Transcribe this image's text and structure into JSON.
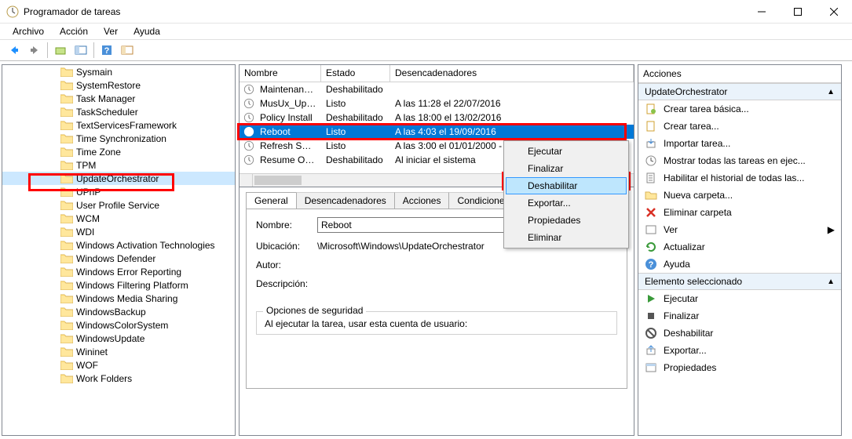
{
  "window": {
    "title": "Programador de tareas"
  },
  "menu": {
    "file": "Archivo",
    "action": "Acción",
    "view": "Ver",
    "help": "Ayuda"
  },
  "tree": {
    "items": [
      "Sysmain",
      "SystemRestore",
      "Task Manager",
      "TaskScheduler",
      "TextServicesFramework",
      "Time Synchronization",
      "Time Zone",
      "TPM",
      "UpdateOrchestrator",
      "UPnP",
      "User Profile Service",
      "WCM",
      "WDI",
      "Windows Activation Technologies",
      "Windows Defender",
      "Windows Error Reporting",
      "Windows Filtering Platform",
      "Windows Media Sharing",
      "WindowsBackup",
      "WindowsColorSystem",
      "WindowsUpdate",
      "Wininet",
      "WOF",
      "Work Folders"
    ],
    "selected_index": 8
  },
  "grid": {
    "headers": {
      "name": "Nombre",
      "state": "Estado",
      "triggers": "Desencadenadores"
    },
    "rows": [
      {
        "name": "Maintenanc...",
        "state": "Deshabilitado",
        "trigger": ""
      },
      {
        "name": "MusUx_Upd...",
        "state": "Listo",
        "trigger": "A las 11:28 el 22/07/2016"
      },
      {
        "name": "Policy Install",
        "state": "Deshabilitado",
        "trigger": "A las 18:00 el 13/02/2016"
      },
      {
        "name": "Reboot",
        "state": "Listo",
        "trigger": "A las 4:03 el 19/09/2016"
      },
      {
        "name": "Refresh Setti...",
        "state": "Listo",
        "trigger": "A las 3:00 el 01/01/2000 - ..."
      },
      {
        "name": "Resume On ...",
        "state": "Deshabilitado",
        "trigger": "Al iniciar el sistema"
      }
    ],
    "selected_index": 3
  },
  "context_menu": {
    "items": [
      "Ejecutar",
      "Finalizar",
      "Deshabilitar",
      "Exportar...",
      "Propiedades",
      "Eliminar"
    ],
    "hover_index": 2
  },
  "details": {
    "tabs": [
      "General",
      "Desencadenadores",
      "Acciones",
      "Condiciones"
    ],
    "name_label": "Nombre:",
    "name_value": "Reboot",
    "location_label": "Ubicación:",
    "location_value": "\\Microsoft\\Windows\\UpdateOrchestrator",
    "author_label": "Autor:",
    "author_value": "",
    "desc_label": "Descripción:",
    "security_legend": "Opciones de seguridad",
    "security_line": "Al ejecutar la tarea, usar esta cuenta de usuario:"
  },
  "actions": {
    "header": "Acciones",
    "section1": "UpdateOrchestrator",
    "items1": [
      {
        "icon": "doc",
        "label": "Crear tarea básica..."
      },
      {
        "icon": "doc2",
        "label": "Crear tarea..."
      },
      {
        "icon": "import",
        "label": "Importar tarea..."
      },
      {
        "icon": "clock",
        "label": "Mostrar todas las tareas en ejec..."
      },
      {
        "icon": "log",
        "label": "Habilitar el historial de todas las..."
      },
      {
        "icon": "folder",
        "label": "Nueva carpeta..."
      },
      {
        "icon": "x",
        "label": "Eliminar carpeta"
      },
      {
        "icon": "view",
        "label": "Ver",
        "arrow": true
      },
      {
        "icon": "refresh",
        "label": "Actualizar"
      },
      {
        "icon": "help",
        "label": "Ayuda"
      }
    ],
    "section2": "Elemento seleccionado",
    "items2": [
      {
        "icon": "play",
        "label": "Ejecutar"
      },
      {
        "icon": "stop",
        "label": "Finalizar"
      },
      {
        "icon": "disable",
        "label": "Deshabilitar"
      },
      {
        "icon": "export",
        "label": "Exportar..."
      },
      {
        "icon": "props",
        "label": "Propiedades"
      }
    ]
  }
}
